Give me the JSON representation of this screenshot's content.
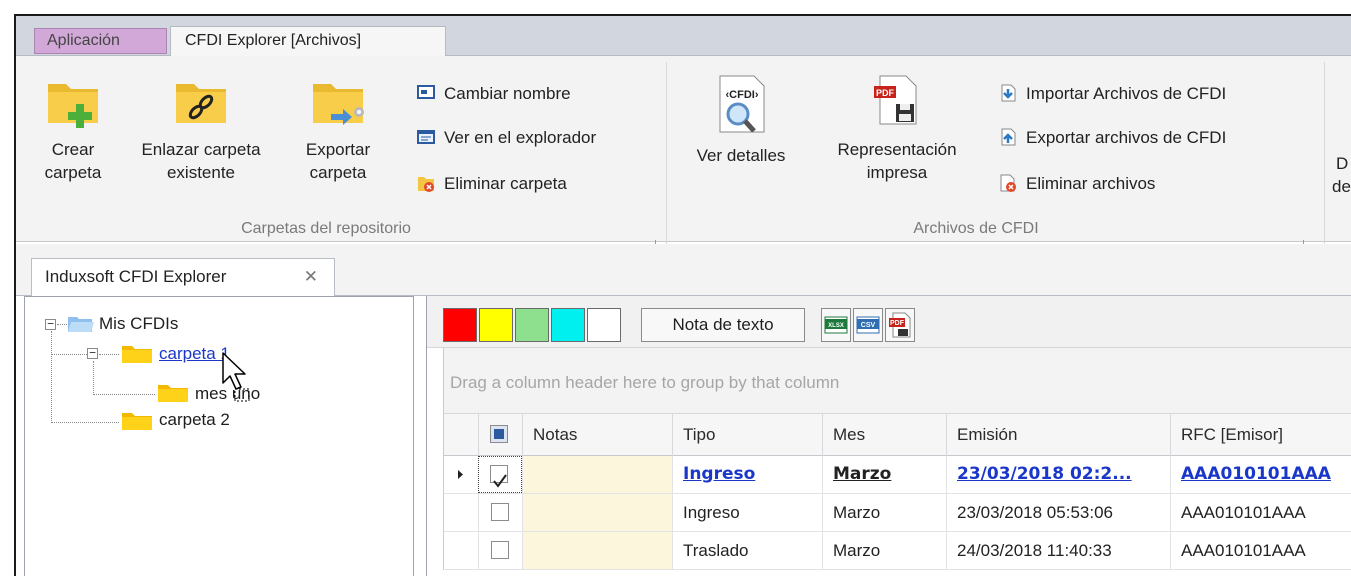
{
  "ribbon_tabs": [
    {
      "label": "Aplicación"
    },
    {
      "label": "CFDI Explorer [Archivos]"
    }
  ],
  "groups": {
    "carpetas": {
      "label": "Carpetas del repositorio",
      "big_buttons": [
        {
          "line1": "Crear",
          "line2": "carpeta",
          "icon": "folder-add-icon"
        },
        {
          "line1": "Enlazar carpeta",
          "line2": "existente",
          "icon": "folder-link-icon"
        },
        {
          "line1": "Exportar",
          "line2": "carpeta",
          "icon": "folder-export-icon"
        }
      ],
      "small_buttons": [
        {
          "label": "Cambiar nombre",
          "icon": "rename-icon"
        },
        {
          "label": "Ver en el explorador",
          "icon": "explorer-icon"
        },
        {
          "label": "Eliminar carpeta",
          "icon": "delete-folder-icon"
        }
      ]
    },
    "archivos": {
      "label": "Archivos de CFDI",
      "big_buttons": [
        {
          "line1": "Ver detalles",
          "line2": "",
          "icon": "cfdi-details-icon",
          "badge": "‹CFDI›"
        },
        {
          "line1": "Representación",
          "line2": "impresa",
          "icon": "pdf-print-icon",
          "badge": "PDF"
        }
      ],
      "small_buttons": [
        {
          "label": "Importar Archivos de CFDI",
          "icon": "import-icon"
        },
        {
          "label": "Exportar archivos de CFDI",
          "icon": "export-icon"
        },
        {
          "label": "Eliminar archivos",
          "icon": "delete-files-icon"
        }
      ]
    },
    "partial": {
      "line1": "D",
      "line2": "de"
    }
  },
  "document_tab": {
    "label": "Induxsoft CFDI Explorer",
    "close": "✕"
  },
  "tree": {
    "root": "Mis CFDIs",
    "nodes": [
      {
        "label": "carpeta 1",
        "link": true
      },
      {
        "label": "mes uno",
        "link": false
      },
      {
        "label": "carpeta 2",
        "link": false
      }
    ]
  },
  "toolbar": {
    "colors": [
      "#ff0000",
      "#ffff00",
      "#8ee08e",
      "#00f0f0",
      "#ffffff"
    ],
    "note_button": "Nota de texto",
    "export_buttons": [
      {
        "badge": "XLSX",
        "icon": "xlsx-icon"
      },
      {
        "badge": "CSV",
        "icon": "csv-icon"
      },
      {
        "badge": "PDF",
        "icon": "pdf-icon"
      }
    ]
  },
  "grid": {
    "group_hint": "Drag a column header here to group by that column",
    "columns": [
      "",
      "Notas",
      "Tipo",
      "Mes",
      "Emisión",
      "RFC [Emisor]"
    ],
    "rows": [
      {
        "checked": true,
        "notas": "",
        "tipo": "Ingreso",
        "mes": "Marzo",
        "emision": "23/03/2018 02:2...",
        "rfc": "AAA010101AAA",
        "selected": true
      },
      {
        "checked": false,
        "notas": "",
        "tipo": "Ingreso",
        "mes": "Marzo",
        "emision": "23/03/2018 05:53:06",
        "rfc": "AAA010101AAA",
        "selected": false
      },
      {
        "checked": false,
        "notas": "",
        "tipo": "Traslado",
        "mes": "Marzo",
        "emision": "24/03/2018 11:40:33",
        "rfc": "AAA010101AAA",
        "selected": false
      }
    ]
  }
}
